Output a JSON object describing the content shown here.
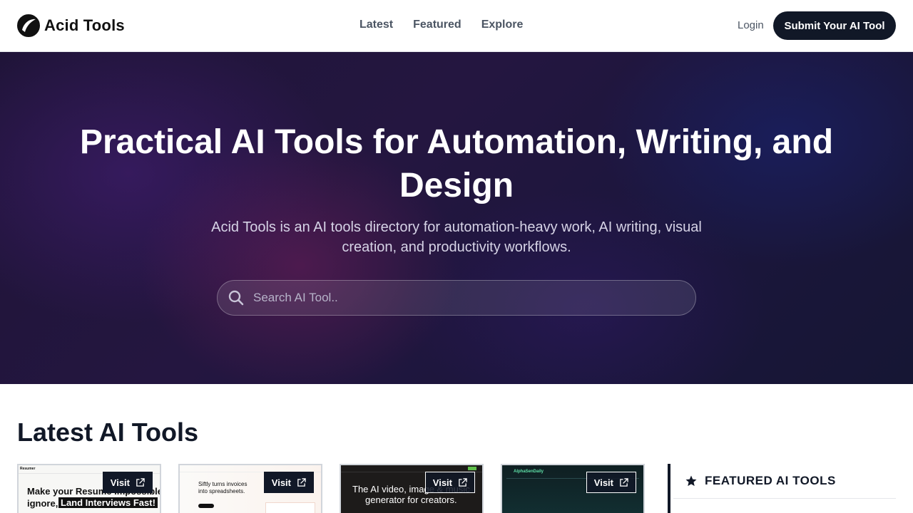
{
  "brand": {
    "name": "Acid Tools"
  },
  "nav": {
    "items": [
      "Latest",
      "Featured",
      "Explore"
    ]
  },
  "header": {
    "login": "Login",
    "submit": "Submit Your AI Tool"
  },
  "hero": {
    "title": "Practical AI Tools for Automation, Writing, and Design",
    "subtitle": "Acid Tools is an AI tools directory for automation-heavy work, AI writing, visual creation, and productivity workflows.",
    "search_placeholder": "Search AI Tool.."
  },
  "latest": {
    "title": "Latest AI Tools",
    "visit_label": "Visit",
    "cards": [
      {
        "line1": "Make your Resume impossible to",
        "line2a": "ignore,",
        "line2b": "Land Interviews Fast!",
        "brand": "Resumer"
      },
      {
        "line1": "Siftly turns invoices",
        "line2": "into spreadsheets."
      },
      {
        "line1": "The AI video, image & music",
        "line2": "generator for creators."
      },
      {
        "brand": "AlphaSenDaily"
      }
    ]
  },
  "featured": {
    "title": "FEATURED AI TOOLS"
  }
}
